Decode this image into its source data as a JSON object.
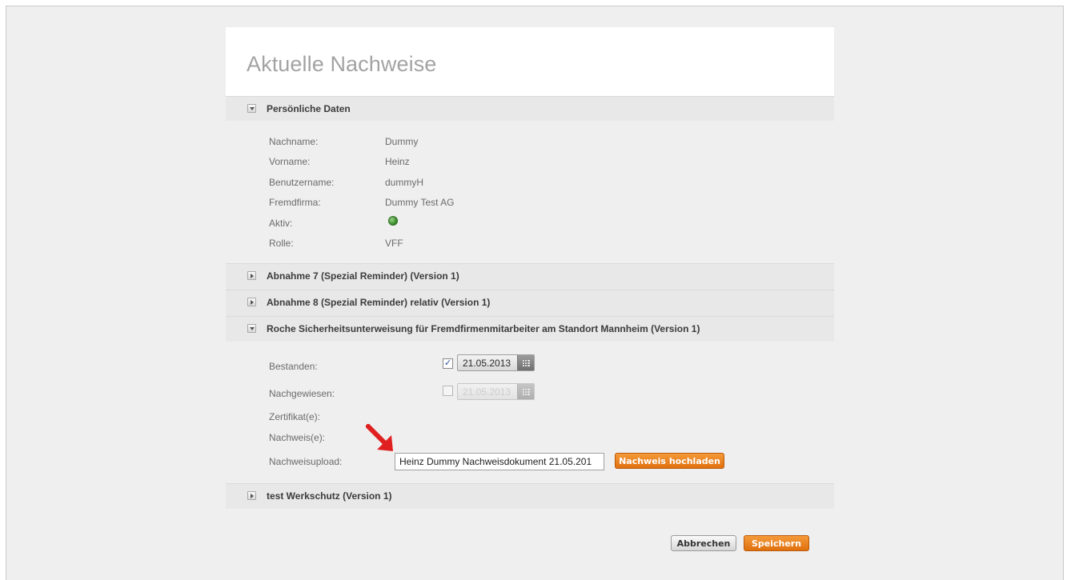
{
  "page": {
    "title": "Aktuelle Nachweise"
  },
  "sections": {
    "personal": {
      "label": "Persönliche Daten",
      "fields": [
        {
          "key": "Nachname:",
          "value": "Dummy"
        },
        {
          "key": "Vorname:",
          "value": "Heinz"
        },
        {
          "key": "Benutzername:",
          "value": "dummyH"
        },
        {
          "key": "Fremdfirma:",
          "value": "Dummy Test AG"
        },
        {
          "key": "Aktiv:",
          "value": ""
        },
        {
          "key": "Rolle:",
          "value": "VFF"
        }
      ],
      "active_color": "#3d8f2d"
    },
    "abnahme7": {
      "label": "Abnahme 7 (Spezial Reminder) (Version 1)"
    },
    "abnahme8": {
      "label": "Abnahme 8 (Spezial Reminder) relativ (Version 1)"
    },
    "roche": {
      "label": "Roche Sicherheitsunterweisung für Fremdfirmenmitarbeiter am Standort Mannheim (Version 1)",
      "bestanden": {
        "label": "Bestanden:",
        "checked": true,
        "date": "21.05.2013"
      },
      "nachgewiesen": {
        "label": "Nachgewiesen:",
        "checked": false,
        "date": "21.05.2013"
      },
      "zertifikat_label": "Zertifikat(e):",
      "nachweis_label": "Nachweis(e):",
      "upload": {
        "label": "Nachweisupload:",
        "value": "Heinz Dummy Nachweisdokument 21.05.201",
        "button": "Nachweis hochladen"
      }
    },
    "werkschutz": {
      "label": "test Werkschutz (Version 1)"
    }
  },
  "footer": {
    "cancel": "Abbrechen",
    "save": "Speichern"
  },
  "colors": {
    "accent": "#e8801f",
    "arrow": "#e02020"
  }
}
